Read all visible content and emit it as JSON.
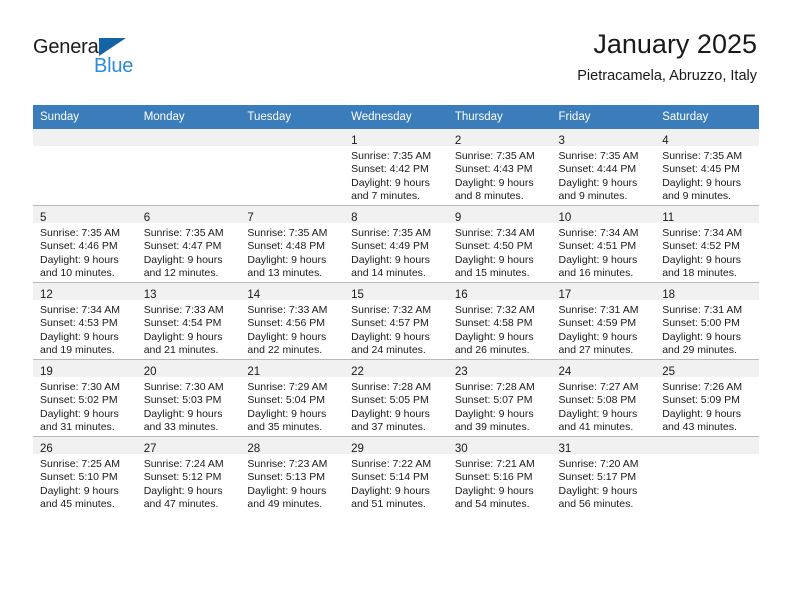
{
  "brand": {
    "name_part1": "General",
    "name_part2": "Blue",
    "logo_icon": "triangle-logo-icon"
  },
  "header": {
    "title": "January 2025",
    "subtitle": "Pietracamela, Abruzzo, Italy"
  },
  "colors": {
    "header_blue": "#3b7cba",
    "brand_blue": "#2e8bd4",
    "logo_blue": "#1565a6",
    "daynum_band": "#f1f1f1",
    "row_border": "#b8b8b8"
  },
  "weekday_headers": [
    "Sunday",
    "Monday",
    "Tuesday",
    "Wednesday",
    "Thursday",
    "Friday",
    "Saturday"
  ],
  "weeks": [
    [
      {
        "day": "",
        "lines": []
      },
      {
        "day": "",
        "lines": []
      },
      {
        "day": "",
        "lines": []
      },
      {
        "day": "1",
        "lines": [
          "Sunrise: 7:35 AM",
          "Sunset: 4:42 PM",
          "Daylight: 9 hours",
          "and 7 minutes."
        ]
      },
      {
        "day": "2",
        "lines": [
          "Sunrise: 7:35 AM",
          "Sunset: 4:43 PM",
          "Daylight: 9 hours",
          "and 8 minutes."
        ]
      },
      {
        "day": "3",
        "lines": [
          "Sunrise: 7:35 AM",
          "Sunset: 4:44 PM",
          "Daylight: 9 hours",
          "and 9 minutes."
        ]
      },
      {
        "day": "4",
        "lines": [
          "Sunrise: 7:35 AM",
          "Sunset: 4:45 PM",
          "Daylight: 9 hours",
          "and 9 minutes."
        ]
      }
    ],
    [
      {
        "day": "5",
        "lines": [
          "Sunrise: 7:35 AM",
          "Sunset: 4:46 PM",
          "Daylight: 9 hours",
          "and 10 minutes."
        ]
      },
      {
        "day": "6",
        "lines": [
          "Sunrise: 7:35 AM",
          "Sunset: 4:47 PM",
          "Daylight: 9 hours",
          "and 12 minutes."
        ]
      },
      {
        "day": "7",
        "lines": [
          "Sunrise: 7:35 AM",
          "Sunset: 4:48 PM",
          "Daylight: 9 hours",
          "and 13 minutes."
        ]
      },
      {
        "day": "8",
        "lines": [
          "Sunrise: 7:35 AM",
          "Sunset: 4:49 PM",
          "Daylight: 9 hours",
          "and 14 minutes."
        ]
      },
      {
        "day": "9",
        "lines": [
          "Sunrise: 7:34 AM",
          "Sunset: 4:50 PM",
          "Daylight: 9 hours",
          "and 15 minutes."
        ]
      },
      {
        "day": "10",
        "lines": [
          "Sunrise: 7:34 AM",
          "Sunset: 4:51 PM",
          "Daylight: 9 hours",
          "and 16 minutes."
        ]
      },
      {
        "day": "11",
        "lines": [
          "Sunrise: 7:34 AM",
          "Sunset: 4:52 PM",
          "Daylight: 9 hours",
          "and 18 minutes."
        ]
      }
    ],
    [
      {
        "day": "12",
        "lines": [
          "Sunrise: 7:34 AM",
          "Sunset: 4:53 PM",
          "Daylight: 9 hours",
          "and 19 minutes."
        ]
      },
      {
        "day": "13",
        "lines": [
          "Sunrise: 7:33 AM",
          "Sunset: 4:54 PM",
          "Daylight: 9 hours",
          "and 21 minutes."
        ]
      },
      {
        "day": "14",
        "lines": [
          "Sunrise: 7:33 AM",
          "Sunset: 4:56 PM",
          "Daylight: 9 hours",
          "and 22 minutes."
        ]
      },
      {
        "day": "15",
        "lines": [
          "Sunrise: 7:32 AM",
          "Sunset: 4:57 PM",
          "Daylight: 9 hours",
          "and 24 minutes."
        ]
      },
      {
        "day": "16",
        "lines": [
          "Sunrise: 7:32 AM",
          "Sunset: 4:58 PM",
          "Daylight: 9 hours",
          "and 26 minutes."
        ]
      },
      {
        "day": "17",
        "lines": [
          "Sunrise: 7:31 AM",
          "Sunset: 4:59 PM",
          "Daylight: 9 hours",
          "and 27 minutes."
        ]
      },
      {
        "day": "18",
        "lines": [
          "Sunrise: 7:31 AM",
          "Sunset: 5:00 PM",
          "Daylight: 9 hours",
          "and 29 minutes."
        ]
      }
    ],
    [
      {
        "day": "19",
        "lines": [
          "Sunrise: 7:30 AM",
          "Sunset: 5:02 PM",
          "Daylight: 9 hours",
          "and 31 minutes."
        ]
      },
      {
        "day": "20",
        "lines": [
          "Sunrise: 7:30 AM",
          "Sunset: 5:03 PM",
          "Daylight: 9 hours",
          "and 33 minutes."
        ]
      },
      {
        "day": "21",
        "lines": [
          "Sunrise: 7:29 AM",
          "Sunset: 5:04 PM",
          "Daylight: 9 hours",
          "and 35 minutes."
        ]
      },
      {
        "day": "22",
        "lines": [
          "Sunrise: 7:28 AM",
          "Sunset: 5:05 PM",
          "Daylight: 9 hours",
          "and 37 minutes."
        ]
      },
      {
        "day": "23",
        "lines": [
          "Sunrise: 7:28 AM",
          "Sunset: 5:07 PM",
          "Daylight: 9 hours",
          "and 39 minutes."
        ]
      },
      {
        "day": "24",
        "lines": [
          "Sunrise: 7:27 AM",
          "Sunset: 5:08 PM",
          "Daylight: 9 hours",
          "and 41 minutes."
        ]
      },
      {
        "day": "25",
        "lines": [
          "Sunrise: 7:26 AM",
          "Sunset: 5:09 PM",
          "Daylight: 9 hours",
          "and 43 minutes."
        ]
      }
    ],
    [
      {
        "day": "26",
        "lines": [
          "Sunrise: 7:25 AM",
          "Sunset: 5:10 PM",
          "Daylight: 9 hours",
          "and 45 minutes."
        ]
      },
      {
        "day": "27",
        "lines": [
          "Sunrise: 7:24 AM",
          "Sunset: 5:12 PM",
          "Daylight: 9 hours",
          "and 47 minutes."
        ]
      },
      {
        "day": "28",
        "lines": [
          "Sunrise: 7:23 AM",
          "Sunset: 5:13 PM",
          "Daylight: 9 hours",
          "and 49 minutes."
        ]
      },
      {
        "day": "29",
        "lines": [
          "Sunrise: 7:22 AM",
          "Sunset: 5:14 PM",
          "Daylight: 9 hours",
          "and 51 minutes."
        ]
      },
      {
        "day": "30",
        "lines": [
          "Sunrise: 7:21 AM",
          "Sunset: 5:16 PM",
          "Daylight: 9 hours",
          "and 54 minutes."
        ]
      },
      {
        "day": "31",
        "lines": [
          "Sunrise: 7:20 AM",
          "Sunset: 5:17 PM",
          "Daylight: 9 hours",
          "and 56 minutes."
        ]
      },
      {
        "day": "",
        "lines": []
      }
    ]
  ]
}
